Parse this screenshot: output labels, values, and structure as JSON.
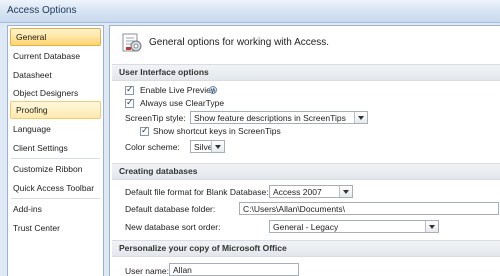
{
  "window": {
    "title": "Access Options"
  },
  "sidebar": {
    "items": [
      {
        "label": "General",
        "state": "selected"
      },
      {
        "label": "Current Database"
      },
      {
        "label": "Datasheet"
      },
      {
        "label": "Object Designers"
      },
      {
        "label": "Proofing",
        "state": "hover"
      },
      {
        "label": "Language"
      },
      {
        "label": "Client Settings"
      },
      {
        "label": "Customize Ribbon"
      },
      {
        "label": "Quick Access Toolbar"
      },
      {
        "label": "Add-ins"
      },
      {
        "label": "Trust Center"
      }
    ]
  },
  "header": {
    "text": "General options for working with Access.",
    "icon": "options-settings-icon"
  },
  "ui_options": {
    "section_title": "User Interface options",
    "live_preview": {
      "label": "Enable Live Preview",
      "checked": true,
      "info_icon": "i"
    },
    "cleartype": {
      "label": "Always use ClearType",
      "checked": true
    },
    "screentip_style": {
      "label": "ScreenTip style:",
      "value": "Show feature descriptions in ScreenTips"
    },
    "shortcut_keys": {
      "label": "Show shortcut keys in ScreenTips",
      "checked": true
    },
    "color_scheme": {
      "label": "Color scheme:",
      "value": "Silver"
    }
  },
  "creating_db": {
    "section_title": "Creating databases",
    "file_format": {
      "label": "Default file format for Blank Database:",
      "value": "Access 2007"
    },
    "db_folder": {
      "label": "Default database folder:",
      "value": "C:\\Users\\Allan\\Documents\\"
    },
    "sort_order": {
      "label": "New database sort order:",
      "value": "General - Legacy"
    }
  },
  "personalize": {
    "section_title": "Personalize your copy of Microsoft Office",
    "user_name": {
      "label": "User name:",
      "value": "Allan"
    }
  }
}
